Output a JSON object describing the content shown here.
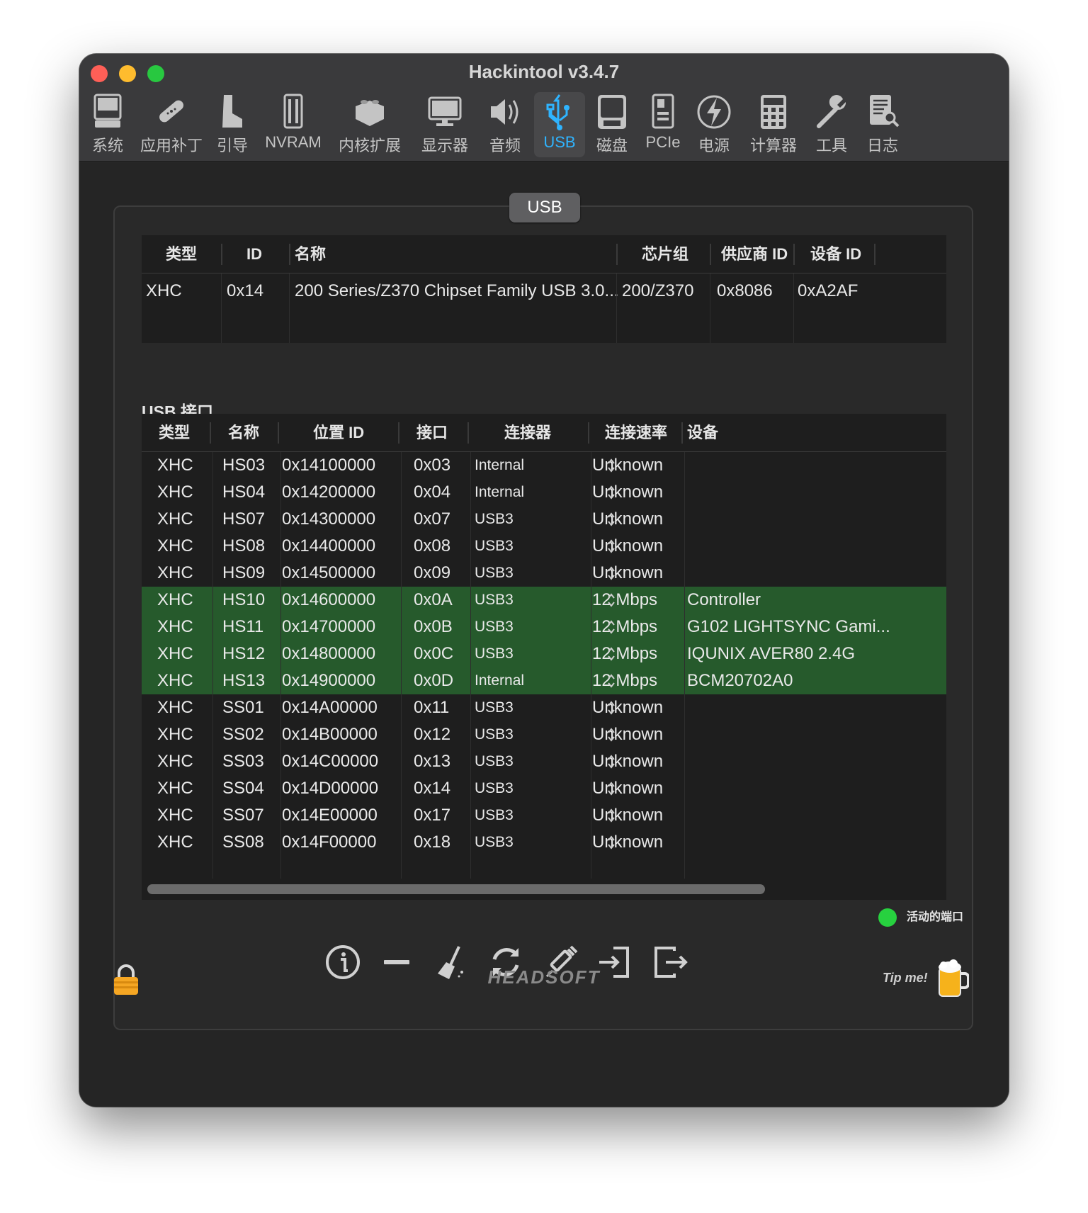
{
  "window": {
    "title": "Hackintool v3.4.7"
  },
  "toolbar": [
    {
      "label": "系统",
      "icon": "system-icon"
    },
    {
      "label": "应用补丁",
      "icon": "patch-icon"
    },
    {
      "label": "引导",
      "icon": "boot-icon"
    },
    {
      "label": "NVRAM",
      "icon": "nvram-icon"
    },
    {
      "label": "内核扩展",
      "icon": "kext-icon"
    },
    {
      "label": "显示器",
      "icon": "display-icon"
    },
    {
      "label": "音频",
      "icon": "audio-icon"
    },
    {
      "label": "USB",
      "icon": "usb-icon",
      "active": true
    },
    {
      "label": "磁盘",
      "icon": "disk-icon"
    },
    {
      "label": "PCIe",
      "icon": "pcie-icon"
    },
    {
      "label": "电源",
      "icon": "power-icon"
    },
    {
      "label": "计算器",
      "icon": "calculator-icon"
    },
    {
      "label": "工具",
      "icon": "tools-icon"
    },
    {
      "label": "日志",
      "icon": "log-icon"
    }
  ],
  "segment": {
    "label": "USB"
  },
  "controllers": {
    "headers": [
      "类型",
      "ID",
      "名称",
      "芯片组",
      "供应商 ID",
      "设备 ID"
    ],
    "rows": [
      [
        "XHC",
        "0x14",
        "200 Series/Z370 Chipset Family USB 3.0...",
        "200/Z370",
        "0x8086",
        "0xA2AF"
      ]
    ]
  },
  "ports_section_title": "USB 接口",
  "ports": {
    "headers": [
      "类型",
      "名称",
      "位置 ID",
      "接口",
      "连接器",
      "连接速率",
      "设备"
    ],
    "rows": [
      {
        "type": "XHC",
        "name": "HS03",
        "location": "0x14100000",
        "port": "0x03",
        "connector": "Internal",
        "speed": "Unknown",
        "device": "",
        "active": false
      },
      {
        "type": "XHC",
        "name": "HS04",
        "location": "0x14200000",
        "port": "0x04",
        "connector": "Internal",
        "speed": "Unknown",
        "device": "",
        "active": false
      },
      {
        "type": "XHC",
        "name": "HS07",
        "location": "0x14300000",
        "port": "0x07",
        "connector": "USB3",
        "speed": "Unknown",
        "device": "",
        "active": false
      },
      {
        "type": "XHC",
        "name": "HS08",
        "location": "0x14400000",
        "port": "0x08",
        "connector": "USB3",
        "speed": "Unknown",
        "device": "",
        "active": false
      },
      {
        "type": "XHC",
        "name": "HS09",
        "location": "0x14500000",
        "port": "0x09",
        "connector": "USB3",
        "speed": "Unknown",
        "device": "",
        "active": false
      },
      {
        "type": "XHC",
        "name": "HS10",
        "location": "0x14600000",
        "port": "0x0A",
        "connector": "USB3",
        "speed": "12 Mbps",
        "device": "Controller",
        "active": true
      },
      {
        "type": "XHC",
        "name": "HS11",
        "location": "0x14700000",
        "port": "0x0B",
        "connector": "USB3",
        "speed": "12 Mbps",
        "device": "G102 LIGHTSYNC Gami...",
        "active": true
      },
      {
        "type": "XHC",
        "name": "HS12",
        "location": "0x14800000",
        "port": "0x0C",
        "connector": "USB3",
        "speed": "12 Mbps",
        "device": "IQUNIX AVER80 2.4G",
        "active": true
      },
      {
        "type": "XHC",
        "name": "HS13",
        "location": "0x14900000",
        "port": "0x0D",
        "connector": "Internal",
        "speed": "12 Mbps",
        "device": "BCM20702A0",
        "active": true
      },
      {
        "type": "XHC",
        "name": "SS01",
        "location": "0x14A00000",
        "port": "0x11",
        "connector": "USB3",
        "speed": "Unknown",
        "device": "",
        "active": false
      },
      {
        "type": "XHC",
        "name": "SS02",
        "location": "0x14B00000",
        "port": "0x12",
        "connector": "USB3",
        "speed": "Unknown",
        "device": "",
        "active": false
      },
      {
        "type": "XHC",
        "name": "SS03",
        "location": "0x14C00000",
        "port": "0x13",
        "connector": "USB3",
        "speed": "Unknown",
        "device": "",
        "active": false
      },
      {
        "type": "XHC",
        "name": "SS04",
        "location": "0x14D00000",
        "port": "0x14",
        "connector": "USB3",
        "speed": "Unknown",
        "device": "",
        "active": false
      },
      {
        "type": "XHC",
        "name": "SS07",
        "location": "0x14E00000",
        "port": "0x17",
        "connector": "USB3",
        "speed": "Unknown",
        "device": "",
        "active": false
      },
      {
        "type": "XHC",
        "name": "SS08",
        "location": "0x14F00000",
        "port": "0x18",
        "connector": "USB3",
        "speed": "Unknown",
        "device": "",
        "active": false
      }
    ]
  },
  "legend": {
    "label": "活动的端口",
    "color": "#27d13f"
  },
  "actions": [
    "info-icon",
    "remove-icon",
    "clean-icon",
    "refresh-icon",
    "inject-icon",
    "import-icon",
    "export-icon"
  ],
  "footer": {
    "brand": "HEADSOFT",
    "tip": "Tip me!"
  },
  "colors": {
    "accent": "#2fb4ff",
    "active_row": "#265a2c"
  }
}
